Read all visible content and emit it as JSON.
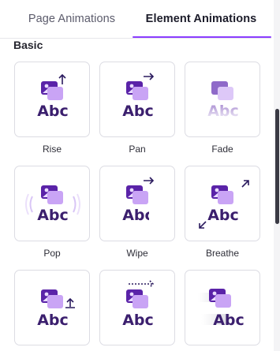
{
  "tabs": {
    "page_animations": "Page Animations",
    "element_animations": "Element Animations",
    "active": "element_animations"
  },
  "section": {
    "heading": "Basic"
  },
  "animations": [
    {
      "label": "Rise",
      "sample_text": "Abc"
    },
    {
      "label": "Pan",
      "sample_text": "Abc"
    },
    {
      "label": "Fade",
      "sample_text": "Abc"
    },
    {
      "label": "Pop",
      "sample_text": "Abc"
    },
    {
      "label": "Wipe",
      "sample_text": "Abc"
    },
    {
      "label": "Breathe",
      "sample_text": "Abc"
    },
    {
      "label": "",
      "sample_text": "Abc"
    },
    {
      "label": "",
      "sample_text": "Abc"
    },
    {
      "label": "",
      "sample_text": "Abc"
    }
  ],
  "colors": {
    "accent": "#8b3dff",
    "icon_dark": "#5a23a8",
    "icon_light": "#c9a4f5",
    "text_dark": "#3b1f6e"
  }
}
